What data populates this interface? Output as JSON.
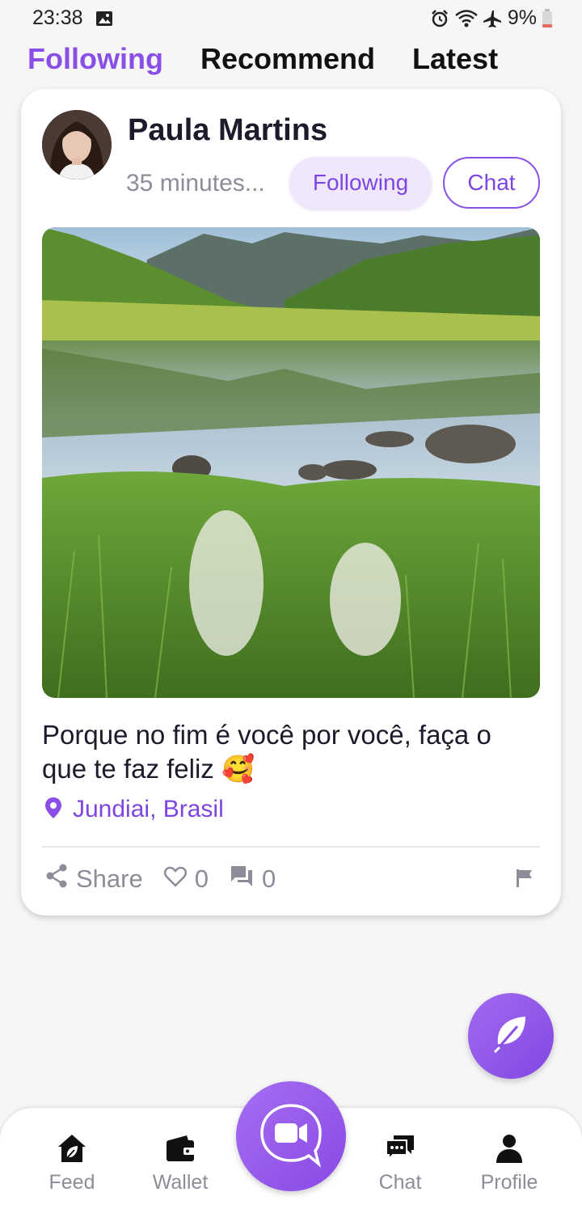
{
  "status_bar": {
    "time": "23:38",
    "battery": "9%",
    "icons": [
      "image-icon",
      "alarm-icon",
      "wifi-icon",
      "airplane-icon",
      "battery-low-icon"
    ]
  },
  "tabs": [
    {
      "label": "Following",
      "active": true
    },
    {
      "label": "Recommend",
      "active": false
    },
    {
      "label": "Latest",
      "active": false
    }
  ],
  "post": {
    "author": "Paula Martins",
    "time": "35 minutes...",
    "following_label": "Following",
    "chat_label": "Chat",
    "text": "Porque no fim é você por você, faça o que te faz feliz 🥰",
    "location": "Jundiai, Brasil",
    "actions": {
      "share_label": "Share",
      "likes": "0",
      "comments": "0"
    }
  },
  "bottom_nav": {
    "items": [
      {
        "label": "Feed",
        "icon": "home-leaf-icon"
      },
      {
        "label": "Wallet",
        "icon": "wallet-icon"
      },
      {
        "label": "Chat",
        "icon": "chat-bubbles-icon"
      },
      {
        "label": "Profile",
        "icon": "person-icon"
      }
    ],
    "center_icon": "video-call-icon"
  },
  "fab_icon": "leaf-icon",
  "colors": {
    "accent": "#8a4fe6",
    "accent_light": "#efe8fc",
    "muted": "#8e8c99",
    "background": "#f6f6f7"
  }
}
